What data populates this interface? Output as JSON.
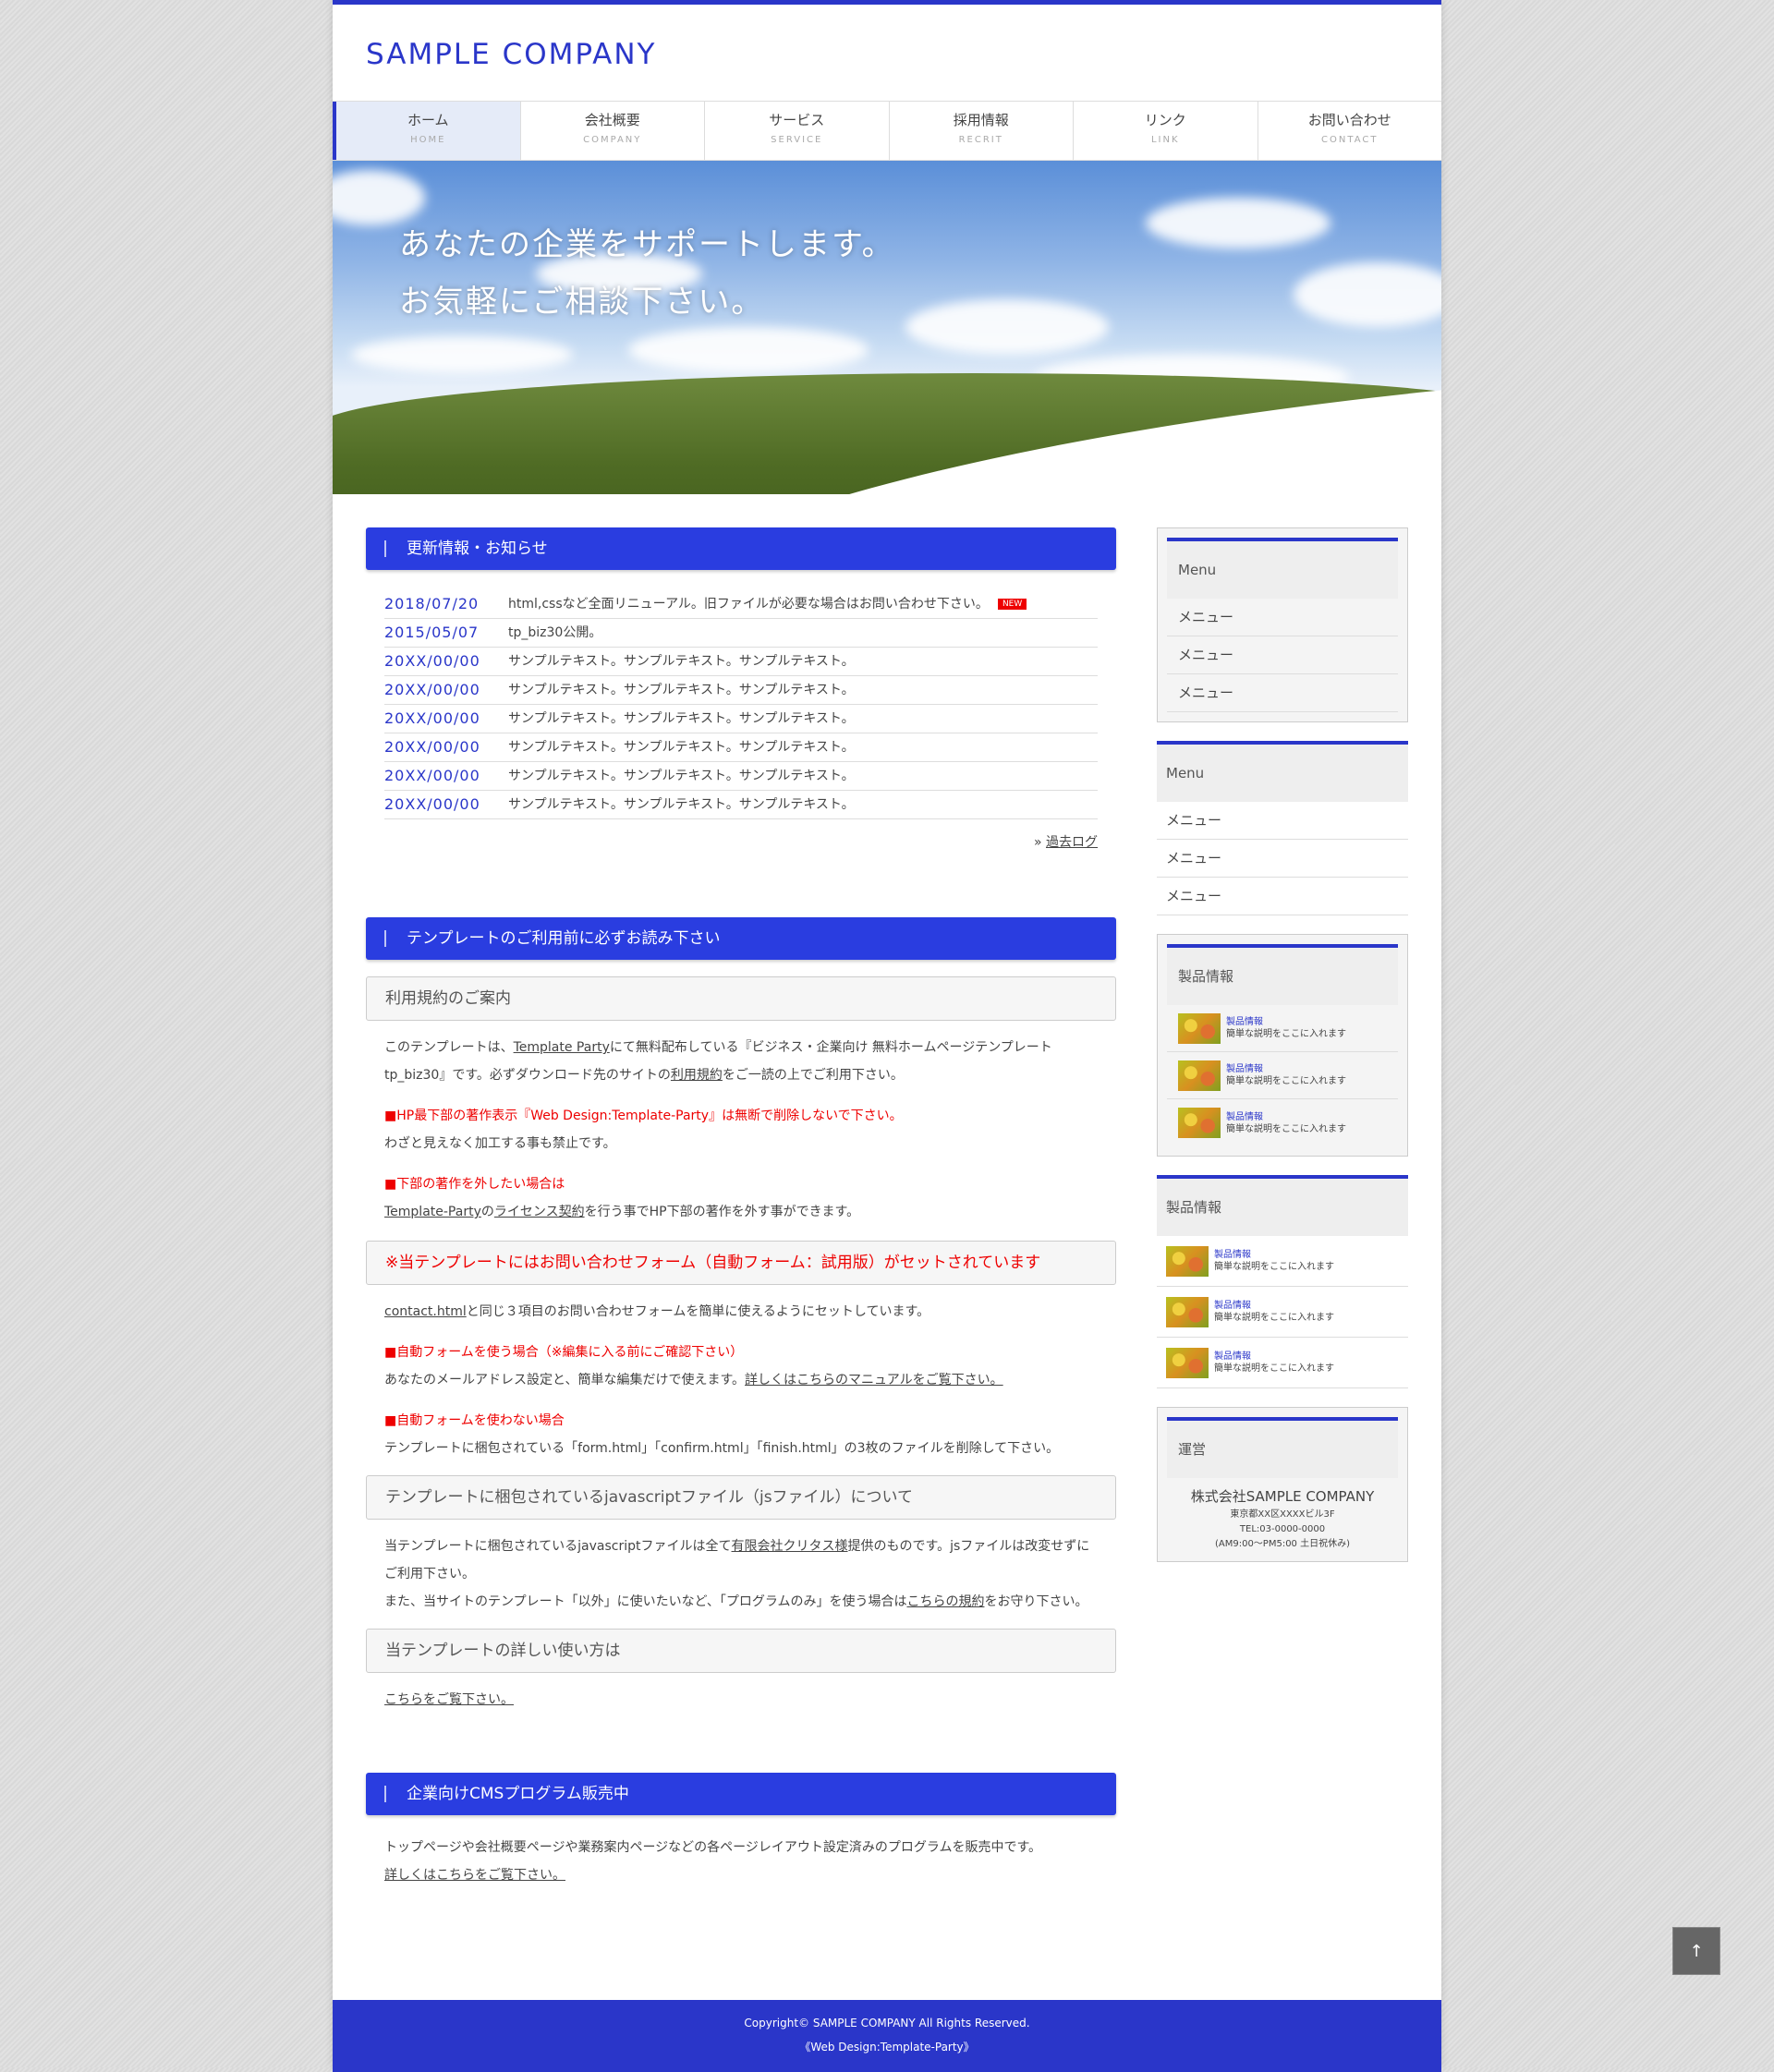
{
  "logo": "SAMPLE COMPANY",
  "nav": [
    {
      "jp": "ホーム",
      "en": "HOME"
    },
    {
      "jp": "会社概要",
      "en": "COMPANY"
    },
    {
      "jp": "サービス",
      "en": "SERVICE"
    },
    {
      "jp": "採用情報",
      "en": "RECRIT"
    },
    {
      "jp": "リンク",
      "en": "LINK"
    },
    {
      "jp": "お問い合わせ",
      "en": "CONTACT"
    }
  ],
  "catch": {
    "line1": "あなたの企業をサポートします。",
    "line2": "お気軽にご相談下さい。"
  },
  "news": {
    "heading": "更新情報・お知らせ",
    "new_badge": "NEW",
    "items": [
      {
        "date": "2018/07/20",
        "text": "html,cssなど全面リニューアル。旧ファイルが必要な場合はお問い合わせ下さい。"
      },
      {
        "date": "2015/05/07",
        "text": "tp_biz30公開。"
      },
      {
        "date": "20XX/00/00",
        "text": "サンプルテキスト。サンプルテキスト。サンプルテキスト。"
      },
      {
        "date": "20XX/00/00",
        "text": "サンプルテキスト。サンプルテキスト。サンプルテキスト。"
      },
      {
        "date": "20XX/00/00",
        "text": "サンプルテキスト。サンプルテキスト。サンプルテキスト。"
      },
      {
        "date": "20XX/00/00",
        "text": "サンプルテキスト。サンプルテキスト。サンプルテキスト。"
      },
      {
        "date": "20XX/00/00",
        "text": "サンプルテキスト。サンプルテキスト。サンプルテキスト。"
      },
      {
        "date": "20XX/00/00",
        "text": "サンプルテキスト。サンプルテキスト。サンプルテキスト。"
      }
    ],
    "more_prefix": "»",
    "more": "過去ログ"
  },
  "template": {
    "heading": "テンプレートのご利用前に必ずお読み下さい",
    "h_terms": "利用規約のご案内",
    "t1a": "このテンプレートは、",
    "t1link": "Template Party",
    "t1b": "にて無料配布している『ビジネス・企業向け 無料ホームページテンプレート tp_biz30』です。必ずダウンロード先のサイトの",
    "t1link2": "利用規約",
    "t1c": "をご一読の上でご利用下さい。",
    "red1": "■HP最下部の著作表示『Web Design:Template-Party』は無断で削除しないで下さい。",
    "t2": "わざと見えなく加工する事も禁止です。",
    "red2": "■下部の著作を外したい場合は",
    "t3link": "Template-Party",
    "t3a": "の",
    "t3link2": "ライセンス契約",
    "t3b": "を行う事でHP下部の著作を外す事ができます。",
    "h_form": "※当テンプレートにはお問い合わせフォーム（自動フォーム：試用版）がセットされています",
    "t4link": "contact.html",
    "t4": "と同じ３項目のお問い合わせフォームを簡単に使えるようにセットしています。",
    "red3": "■自動フォームを使う場合（※編集に入る前にご確認下さい）",
    "t5": "あなたのメールアドレス設定と、簡単な編集だけで使えます。",
    "t5link": "詳しくはこちらのマニュアルをご覧下さい。",
    "red4": "■自動フォームを使わない場合",
    "t6": "テンプレートに梱包されている「form.html」「confirm.html」「finish.html」の3枚のファイルを削除して下さい。",
    "h_js": "テンプレートに梱包されているjavascriptファイル（jsファイル）について",
    "t7a": "当テンプレートに梱包されているjavascriptファイルは全て",
    "t7link": "有限会社クリタス様",
    "t7b": "提供のものです。jsファイルは改変せずにご利用下さい。",
    "t8a": "また、当サイトのテンプレート「以外」に使いたいなど、「プログラムのみ」を使う場合は",
    "t8link": "こちらの規約",
    "t8b": "をお守り下さい。",
    "h_usage": "当テンプレートの詳しい使い方は",
    "t9link": "こちらをご覧下さい。"
  },
  "cms": {
    "heading": "企業向けCMSプログラム販売中",
    "text": "トップページや会社概要ページや業務案内ページなどの各ページレイアウト設定済みのプログラムを販売中です。",
    "link": "詳しくはこちらをご覧下さい。"
  },
  "sidebar": {
    "menu_title": "Menu",
    "menu_item": "メニュー",
    "prod_title": "製品情報",
    "prod_name": "製品情報",
    "prod_desc": "簡単な説明をここに入れます",
    "op_title": "運営",
    "op_name": "株式会社SAMPLE COMPANY",
    "op_addr": "東京都XX区XXXXビル3F",
    "op_tel": "TEL:03-0000-0000",
    "op_hours": "(AM9:00〜PM5:00 土日祝休み)"
  },
  "footer": {
    "copy": "Copyright© SAMPLE COMPANY All Rights Reserved.",
    "credit": "《Web Design:Template-Party》"
  },
  "pagetop": "↑"
}
